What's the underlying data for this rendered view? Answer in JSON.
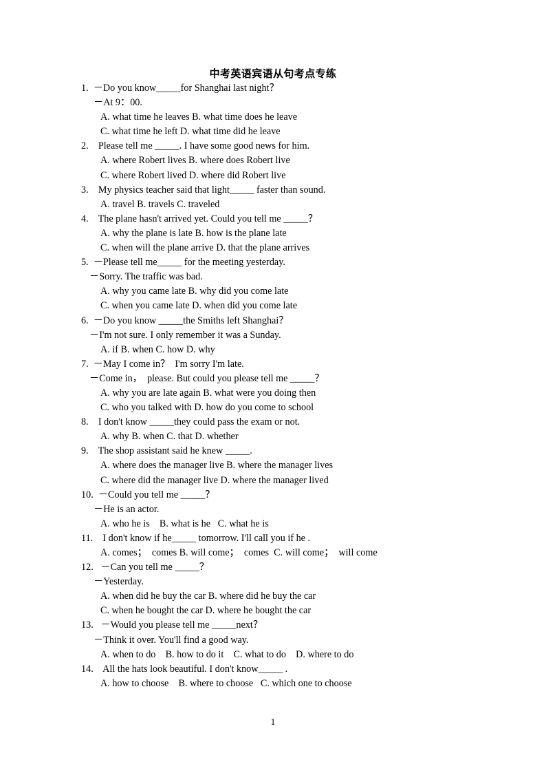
{
  "document": {
    "title": "中考英语宾语从句考点专练",
    "page_number": "1"
  },
  "questions": [
    {
      "number": "1.",
      "lines": [
        {
          "indent": "num",
          "text": "1.  －Do you know_____for Shanghai last night？"
        },
        {
          "indent": "dash",
          "text": "－At 9：00."
        },
        {
          "indent": "opt",
          "text": "A. what time he leaves B. what time does he leave"
        },
        {
          "indent": "opt",
          "text": "C. what time he left D. what time did he leave"
        }
      ]
    },
    {
      "number": "2.",
      "lines": [
        {
          "indent": "num",
          "text": "2.    Please tell me _____. I have some good news for him."
        },
        {
          "indent": "opt",
          "text": "A. where Robert lives B. where does Robert live"
        },
        {
          "indent": "opt",
          "text": "C. where Robert lived D. where did Robert live"
        }
      ]
    },
    {
      "number": "3.",
      "lines": [
        {
          "indent": "num",
          "text": "3.    My physics teacher said that light_____ faster than sound."
        },
        {
          "indent": "opt",
          "text": "A. travel B. travels C. traveled"
        }
      ]
    },
    {
      "number": "4.",
      "lines": [
        {
          "indent": "num",
          "text": "4.    The plane hasn't arrived yet. Could you tell me _____？"
        },
        {
          "indent": "opt",
          "text": "A. why the plane is late B. how is the plane late"
        },
        {
          "indent": "opt",
          "text": "C. when will the plane arrive D. that the plane arrives"
        }
      ]
    },
    {
      "number": "5.",
      "lines": [
        {
          "indent": "num",
          "text": "5.  －Please tell me_____ for the meeting yesterday."
        },
        {
          "indent": "dash2",
          "text": "－Sorry. The traffic was bad."
        },
        {
          "indent": "opt",
          "text": "A. why you came late B. why did you come late"
        },
        {
          "indent": "opt",
          "text": "C. when you came late D. when did you come late"
        }
      ]
    },
    {
      "number": "6.",
      "lines": [
        {
          "indent": "num",
          "text": "6.  －Do you know _____the Smiths left Shanghai？"
        },
        {
          "indent": "dash2",
          "text": "－I'm not sure. I only remember it was a Sunday."
        },
        {
          "indent": "opt",
          "text": "A. if B. when C. how D. why"
        }
      ]
    },
    {
      "number": "7.",
      "lines": [
        {
          "indent": "num",
          "text": "7.  －May I come in？  I'm sorry I'm late."
        },
        {
          "indent": "dash2",
          "text": "－Come in，  please. But could you please tell me _____？"
        },
        {
          "indent": "opt",
          "text": "A. why you are late again B. what were you doing then"
        },
        {
          "indent": "opt",
          "text": "C. who you talked with D. how do you come to school"
        }
      ]
    },
    {
      "number": "8.",
      "lines": [
        {
          "indent": "num",
          "text": "8.    I don't know _____they could pass the exam or not."
        },
        {
          "indent": "opt",
          "text": "A. why B. when C. that D. whether"
        }
      ]
    },
    {
      "number": "9.",
      "lines": [
        {
          "indent": "num",
          "text": "9.    The shop assistant said he knew _____."
        },
        {
          "indent": "opt",
          "text": "A. where does the manager live B. where the manager lives"
        },
        {
          "indent": "opt",
          "text": "C. where did the manager live D. where the manager lived"
        }
      ]
    },
    {
      "number": "10.",
      "lines": [
        {
          "indent": "num",
          "text": "10.  －Could you tell me _____？"
        },
        {
          "indent": "dash",
          "text": "－He is an actor."
        },
        {
          "indent": "opt",
          "text": "A. who he is    B. what is he   C. what he is"
        }
      ]
    },
    {
      "number": "11.",
      "lines": [
        {
          "indent": "num",
          "text": "11.    I don't know if he_____ tomorrow. I'll call you if he ."
        },
        {
          "indent": "opt",
          "text": "A. comes；  comes B. will come；  comes  C. will come；  will come"
        }
      ]
    },
    {
      "number": "12.",
      "lines": [
        {
          "indent": "num",
          "text": "12.   －Can you tell me _____？"
        },
        {
          "indent": "dash",
          "text": "－Yesterday."
        },
        {
          "indent": "opt",
          "text": "A. when did he buy the car B. where did he buy the car"
        },
        {
          "indent": "opt",
          "text": "C. when he bought the car D. where he bought the car"
        }
      ]
    },
    {
      "number": "13.",
      "lines": [
        {
          "indent": "num",
          "text": "13.   －Would you please tell me _____next？"
        },
        {
          "indent": "dash",
          "text": "－Think it over. You'll find a good way."
        },
        {
          "indent": "opt",
          "text": "A. when to do    B. how to do it    C. what to do    D. where to do"
        }
      ]
    },
    {
      "number": "14.",
      "lines": [
        {
          "indent": "num",
          "text": "14.    All the hats look beautiful. I don't know_____ ."
        },
        {
          "indent": "opt",
          "text": "A. how to choose    B. where to choose   C. which one to choose"
        }
      ]
    }
  ]
}
